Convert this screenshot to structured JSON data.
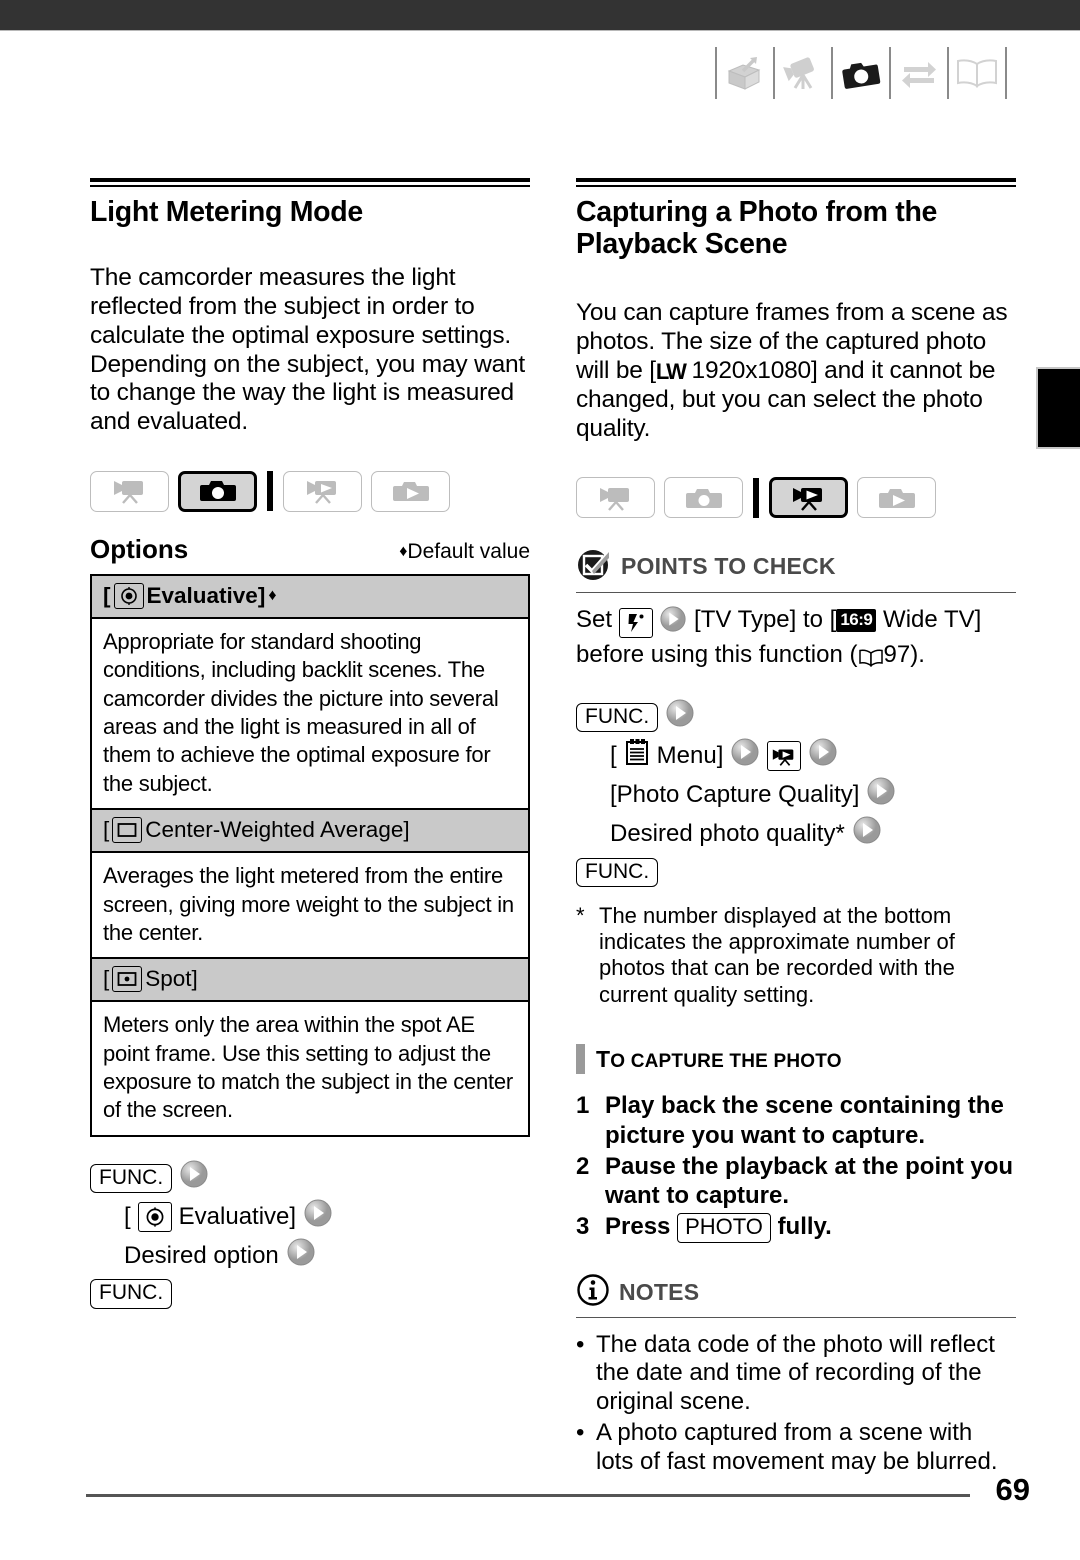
{
  "page": {
    "number": "69",
    "top_bar_color": "#333333",
    "edge_tab_color": "#000000"
  },
  "chapter_strip": {
    "icons": [
      {
        "name": "introduction-box-icon",
        "state": "inactive"
      },
      {
        "name": "video-recording-icon",
        "state": "inactive"
      },
      {
        "name": "photo-recording-icon",
        "state": "active"
      },
      {
        "name": "external-connections-icon",
        "state": "inactive"
      },
      {
        "name": "additional-information-book-icon",
        "state": "inactive"
      }
    ]
  },
  "left_column": {
    "title": "Light Metering Mode",
    "intro": "The camcorder measures the light reflected from the subject in order to calculate the optimal exposure settings. Depending on the subject, you may want to change the way the light is measured and evaluated.",
    "mode_bar": [
      {
        "name": "mode-video-record",
        "active": false
      },
      {
        "name": "mode-photo-record",
        "active": true
      },
      {
        "name": "mode-video-playback",
        "active": false
      },
      {
        "name": "mode-photo-playback",
        "active": false
      }
    ],
    "options_label": "Options",
    "default_marker": "♦",
    "default_note": "Default value",
    "options": [
      {
        "icon": "evaluative-metering-icon",
        "label": "[",
        "name": "Evaluative]",
        "bold": true,
        "is_default": true,
        "description": "Appropriate for standard shooting conditions, including backlit scenes. The camcorder divides the picture into several areas and the light is measured in all of them to achieve the optimal exposure for the subject."
      },
      {
        "icon": "center-weighted-metering-icon",
        "label": "[",
        "name": "Center-Weighted Average]",
        "bold": false,
        "is_default": false,
        "description": "Averages the light metered from the entire screen, giving more weight to the subject in the center."
      },
      {
        "icon": "spot-metering-icon",
        "label": "[",
        "name": "Spot]",
        "bold": false,
        "is_default": false,
        "description": "Meters only the area within the spot AE point frame. Use this setting to adjust the exposure to match the subject in the center of the screen."
      }
    ],
    "sequence": {
      "func_key": "FUNC.",
      "step_evaluative_prefix": "[",
      "step_evaluative": "Evaluative]",
      "step_desired": "Desired option",
      "func_key_end": "FUNC."
    }
  },
  "right_column": {
    "title": "Capturing a Photo from the Playback Scene",
    "intro_part1": "You can capture frames from a scene as photos. The size of the captured photo will be [",
    "intro_badge": "LW",
    "intro_part2": "1920x1080] and it cannot be changed, but you can select the photo quality.",
    "mode_bar": [
      {
        "name": "mode-video-record",
        "active": false
      },
      {
        "name": "mode-photo-record",
        "active": false
      },
      {
        "name": "mode-video-playback",
        "active": true
      },
      {
        "name": "mode-photo-playback",
        "active": false
      }
    ],
    "points_to_check": {
      "title": "POINTS TO CHECK",
      "icon": "checkmark-box-icon",
      "text_before": "Set",
      "text_middle": "[TV Type] to [",
      "ratio_badge": "16:9",
      "text_after": "Wide TV]",
      "text_line2": "before using this function (",
      "page_ref": "97",
      "page_ref_close": ")."
    },
    "sequence": {
      "func_key": "FUNC.",
      "menu_open": "[",
      "menu_label": "Menu]",
      "quality_label": "[Photo Capture Quality]",
      "desired_label": "Desired photo quality*",
      "func_key_end": "FUNC."
    },
    "footnote": {
      "marker": "*",
      "text": "The number displayed at the bottom indicates the approximate number of photos that can be recorded with the current quality setting."
    },
    "capture_subhead": {
      "first": "T",
      "rest": "O CAPTURE THE PHOTO"
    },
    "steps": [
      {
        "num": "1",
        "text": "Play back the scene containing the picture you want to capture."
      },
      {
        "num": "2",
        "text": "Pause the playback at the point you want to capture."
      },
      {
        "num": "3",
        "text_before": "Press",
        "key": "PHOTO",
        "text_after": "fully."
      }
    ],
    "notes": {
      "title": "NOTES",
      "icon": "info-circle-icon",
      "items": [
        "The data code of the photo will reflect the date and time of recording of the original scene.",
        "A photo captured from a scene with lots of fast movement may be blurred."
      ]
    }
  }
}
